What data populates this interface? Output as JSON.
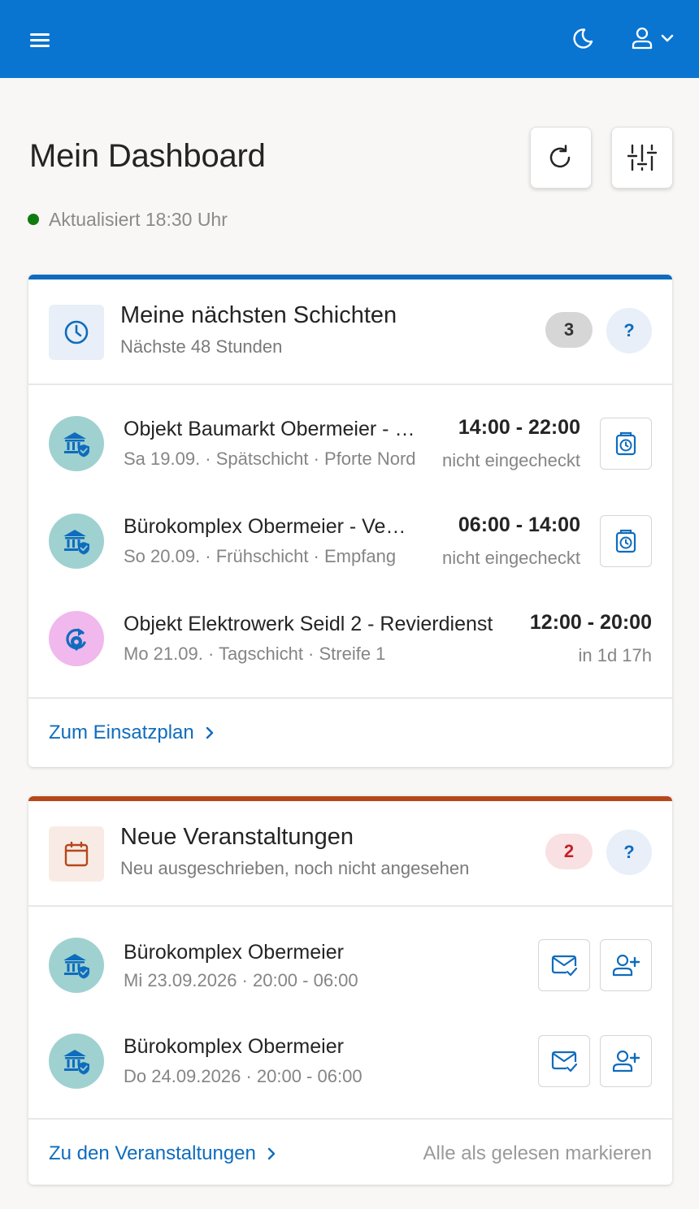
{
  "header": {
    "menu_icon": "hamburger-icon",
    "theme_icon": "moon-icon",
    "user_icon": "person-icon",
    "brand_color": "#0a74d1"
  },
  "dashboard": {
    "title": "Mein Dashboard",
    "updated_text": "Aktualisiert 18:30 Uhr",
    "status_color": "#107c10"
  },
  "shifts": {
    "accent_color": "#0f6cbd",
    "title": "Meine nächsten Schichten",
    "subtitle": "Nächste 48 Stunden",
    "count": "3",
    "help": "?",
    "items": [
      {
        "title": "Objekt Baumarkt Obermeier - Hauptgebäude",
        "meta": "Sa 19.09. · Spätschicht · Pforte Nord",
        "time": "14:00 - 22:00",
        "state": "nicht eingecheckt",
        "icon": "building-shield-icon",
        "action_icon": "clock-in-icon"
      },
      {
        "title": "Bürokomplex Obermeier - Verwaltung",
        "meta": "So 20.09. · Frühschicht · Empfang",
        "time": "06:00 - 14:00",
        "state": "nicht eingecheckt",
        "icon": "building-shield-icon",
        "action_icon": "clock-in-icon"
      },
      {
        "title": "Objekt Elektrowerk Seidl 2 - Revierdienst",
        "meta": "Mo 21.09. · Tagschicht · Streife 1",
        "time": "12:00 - 20:00",
        "state": "in 1d 17h",
        "icon": "patrol-icon"
      }
    ],
    "footer_link": "Zum Einsatzplan"
  },
  "events": {
    "accent_color": "#b7471b",
    "title": "Neue Veranstaltungen",
    "subtitle": "Neu ausgeschrieben, noch nicht angesehen",
    "count": "2",
    "help": "?",
    "items": [
      {
        "title": "Bürokomplex Obermeier",
        "meta": "Mi 23.09.2026 · 20:00 - 06:00",
        "icon": "building-shield-icon"
      },
      {
        "title": "Bürokomplex Obermeier",
        "meta": "Do 24.09.2026 · 20:00 - 06:00",
        "icon": "building-shield-icon"
      }
    ],
    "footer_link": "Zu den Veranstaltungen",
    "footer_action": "Alle als gelesen markieren"
  }
}
